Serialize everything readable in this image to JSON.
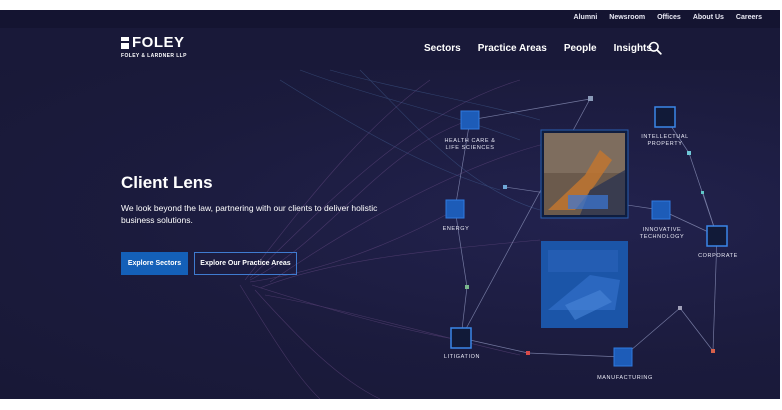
{
  "utility_nav": [
    "Alumni",
    "Newsroom",
    "Offices",
    "About Us",
    "Careers"
  ],
  "logo": {
    "name": "FOLEY",
    "subtitle": "FOLEY & LARDNER LLP"
  },
  "main_nav": [
    "Sectors",
    "Practice Areas",
    "People",
    "Insights"
  ],
  "search_icon": "search-icon",
  "hero": {
    "title": "Client Lens",
    "description": "We look beyond the law, partnering with our clients to deliver holistic business solutions.",
    "primary_button": "Explore Sectors",
    "secondary_button": "Explore Our Practice Areas"
  },
  "network_labels": {
    "health": "HEALTH CARE & LIFE SCIENCES",
    "ip": "INTELLECTUAL PROPERTY",
    "energy": "ENERGY",
    "tech": "INNOVATIVE TECHNOLOGY",
    "corporate": "CORPORATE",
    "litigation": "LITIGATION",
    "manufacturing": "MANUFACTURING"
  },
  "colors": {
    "background": "#1b1b3d",
    "accent_blue": "#1460b8",
    "node_blue": "#1f5fb8"
  }
}
